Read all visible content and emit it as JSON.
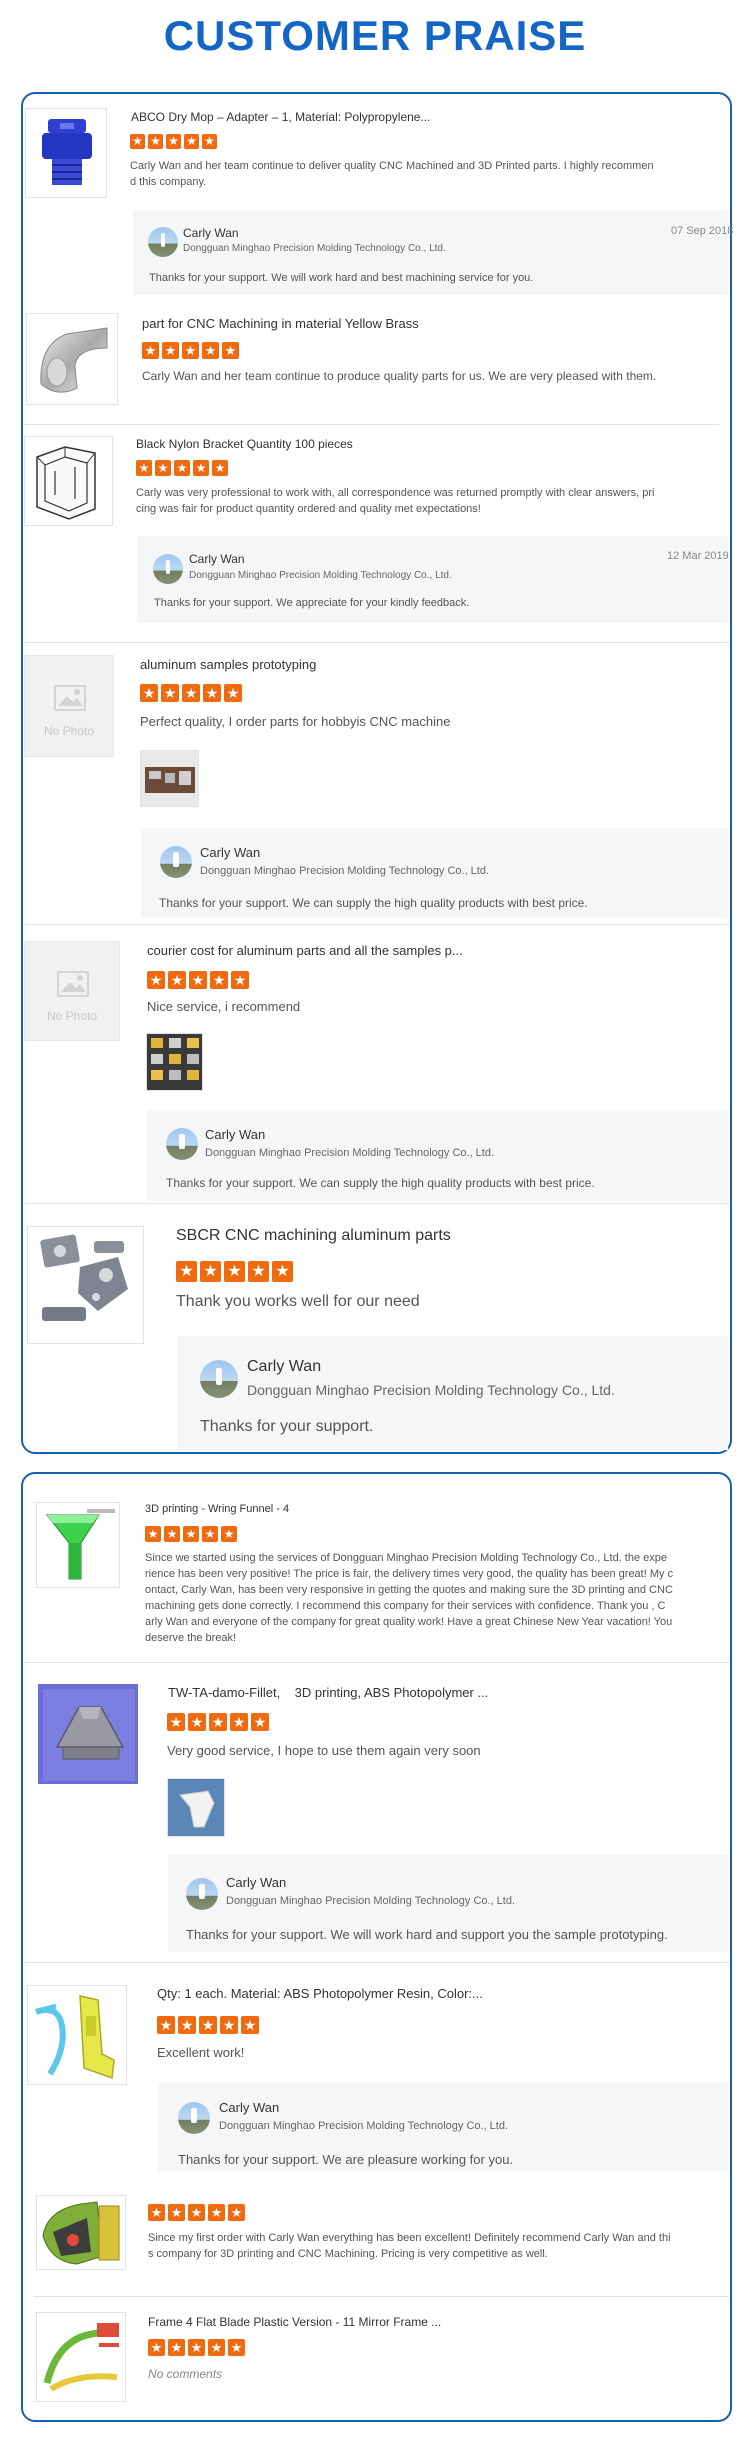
{
  "page_title": "CUSTOMER PRAISE",
  "company": "Dongguan Minghao Precision Molding Technology Co., Ltd.",
  "responder": "Carly Wan",
  "no_photo": "No Photo",
  "colors": {
    "accent": "#1466c6",
    "star": "#f06a10",
    "reply_bg": "#f5f6f8"
  },
  "reviews": [
    {
      "title": "ABCO Dry Mop – Adapter – 1, Material: Polypropylene...",
      "rating": 5,
      "text_lines": [
        "Carly Wan and her team continue to deliver quality CNC Machined and 3D Printed parts. I highly recommen",
        "d this company."
      ],
      "reply": {
        "name": "Carly Wan",
        "date": "07 Sep 2018",
        "text": "Thanks for your support. We will work hard and best machining service for you."
      }
    },
    {
      "title": "part for CNC Machining in material Yellow Brass",
      "rating": 5,
      "text_lines": [
        "Carly Wan and her team continue to produce quality parts for us. We are very pleased with them."
      ]
    },
    {
      "title": "Black Nylon Bracket Quantity 100 pieces",
      "rating": 5,
      "text_lines": [
        "Carly was very professional to work with, all correspondence was returned promptly with clear answers, pri",
        "cing was fair for product quantity ordered and quality met expectations!"
      ],
      "reply": {
        "name": "Carly Wan",
        "date": "12 Mar 2019",
        "text": "Thanks for your support. We appreciate for your kindly feedback."
      }
    },
    {
      "title": "aluminum samples prototyping",
      "rating": 5,
      "text_lines": [
        "Perfect quality, I order parts for hobbyis CNC machine"
      ],
      "reply": {
        "name": "Carly Wan",
        "text": "Thanks for your support. We can supply the high quality products with best price."
      }
    },
    {
      "title": "courier cost for aluminum parts and all the samples p...",
      "rating": 5,
      "text_lines": [
        "Nice service, i recommend"
      ],
      "reply": {
        "name": "Carly Wan",
        "text": "Thanks for your support. We can supply the high quality products with best price."
      }
    },
    {
      "title": "SBCR CNC machining aluminum parts",
      "rating": 5,
      "text_lines": [
        "Thank you works well for our need"
      ],
      "reply": {
        "name": "Carly Wan",
        "text": "Thanks for your support."
      }
    },
    {
      "title": "3D printing - Wring Funnel - 4",
      "rating": 5,
      "text_lines": [
        "Since we started using the services of Dongguan Minghao Precision Molding Technology Co., Ltd. the expe",
        "rience has been very positive! The price is fair, the delivery times very good, the quality has been great! My c",
        "ontact, Carly Wan, has been very responsive in getting the quotes and making sure the 3D printing and CNC",
        "machining gets done correctly. I recommend this company for their services with confidence. Thank you , C",
        "arly Wan and everyone of the company for great quality work! Have a great Chinese New Year vacation! You",
        "deserve the break!"
      ]
    },
    {
      "title": "TW-TA-damo-Fillet,    3D printing, ABS Photopolymer ...",
      "rating": 5,
      "text_lines": [
        "Very good service, I hope to use them again very soon"
      ],
      "reply": {
        "name": "Carly Wan",
        "text": "Thanks for your support. We will work hard and support you the sample prototyping."
      }
    },
    {
      "title": "Qty: 1 each. Material: ABS Photopolymer Resin, Color:...",
      "rating": 5,
      "text_lines": [
        "Excellent work!"
      ],
      "reply": {
        "name": "Carly Wan",
        "text": "Thanks for your support. We are pleasure working for you."
      }
    },
    {
      "title": "",
      "rating": 5,
      "text_lines": [
        "Since my first order with Carly Wan everything has been excellent! Definitely recommend Carly Wan and thi",
        "s company for 3D printing and CNC Machining. Pricing is very competitive as well."
      ]
    },
    {
      "title": "Frame 4 Flat Blade Plastic Version - 11 Mirror Frame ...",
      "rating": 5,
      "text_lines": [
        "No comments"
      ]
    }
  ]
}
